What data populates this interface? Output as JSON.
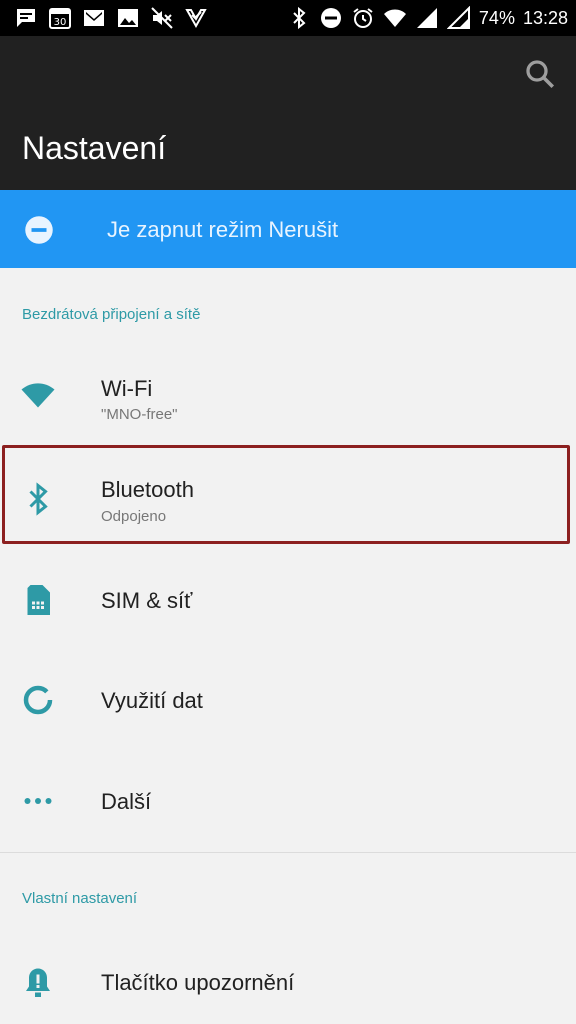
{
  "status_bar": {
    "calendar_day": "30",
    "battery": "74%",
    "time": "13:28",
    "left_icons": [
      "message-icon",
      "calendar-icon",
      "mail-icon",
      "image-icon",
      "mute-icon",
      "task-icon"
    ],
    "right_icons": [
      "bluetooth-icon",
      "dnd-icon",
      "alarm-icon",
      "wifi-icon",
      "signal-icon",
      "signal-icon",
      "battery-icon"
    ]
  },
  "toolbar": {
    "title": "Nastavení",
    "search_icon": "search-icon"
  },
  "dnd_banner": {
    "icon": "dnd-icon",
    "text": "Je zapnut režim Nerušit",
    "color": "#2196f3"
  },
  "sections": {
    "wireless": {
      "header": "Bezdrátová připojení a sítě"
    },
    "custom": {
      "header": "Vlastní nastavení"
    }
  },
  "items": {
    "wifi": {
      "title": "Wi-Fi",
      "subtitle": "\"MNO-free\"",
      "icon": "wifi-icon"
    },
    "bluetooth": {
      "title": "Bluetooth",
      "subtitle": "Odpojeno",
      "icon": "bluetooth-icon"
    },
    "sim": {
      "title": "SIM & síť",
      "icon": "sim-card-icon"
    },
    "data": {
      "title": "Využití dat",
      "icon": "data-usage-icon"
    },
    "more": {
      "title": "Další",
      "icon": "more-icon"
    },
    "alert": {
      "title": "Tlačítko upozornění",
      "icon": "alert-slider-icon"
    }
  },
  "colors": {
    "accent": "#2e9aa6",
    "toolbar": "#212121",
    "highlight_border": "#8c2020"
  }
}
